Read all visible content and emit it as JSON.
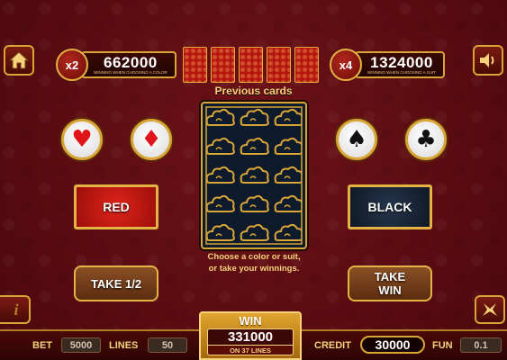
{
  "multipliers": {
    "color": {
      "badge": "x2",
      "value": "662000",
      "caption": "Winning when choosing a color"
    },
    "suit": {
      "badge": "x4",
      "value": "1324000",
      "caption": "Winning when choosing a suit"
    }
  },
  "previous_cards": {
    "label": "Previous cards",
    "count": 5
  },
  "suits": {
    "hearts": {
      "glyph": "♥",
      "color": "#e0141a"
    },
    "diamonds": {
      "glyph": "♦",
      "color": "#e0141a"
    },
    "spades": {
      "glyph": "♠",
      "color": "#111111"
    },
    "clubs": {
      "glyph": "♣",
      "color": "#111111"
    }
  },
  "buttons": {
    "red": "RED",
    "black": "BLACK",
    "take_half": "TAKE 1/2",
    "take_win_line1": "TAKE",
    "take_win_line2": "WIN"
  },
  "instructions": {
    "line1": "Choose a color or suit,",
    "line2": "or take your winnings."
  },
  "bottom_bar": {
    "bet_label": "BET",
    "bet_value": "5000",
    "lines_label": "LINES",
    "lines_value": "50",
    "credit_label": "CREDIT",
    "credit_value": "30000",
    "fun_label": "FUN",
    "fun_value": "0.1"
  },
  "win": {
    "title": "WIN",
    "value": "331000",
    "lines_text": "ON 37 LINES"
  },
  "icons": {
    "home": "home-icon",
    "sound": "speaker-icon",
    "info": "info-icon",
    "paytable": "dragon-icon"
  },
  "colors": {
    "background": "#5c0d12",
    "gold": "#d9a536",
    "label_gold": "#f6d27a",
    "red_button": "#c81a12",
    "black_button": "#1a2638"
  }
}
